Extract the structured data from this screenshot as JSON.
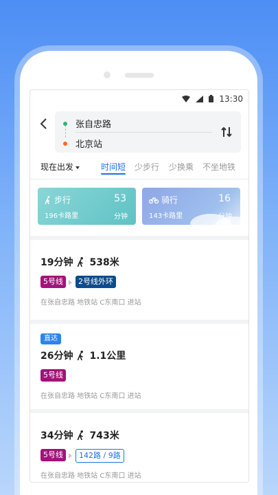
{
  "status": {
    "time": "13:30"
  },
  "route": {
    "from": "张自忠路",
    "to": "北京站"
  },
  "options": {
    "depart_label": "现在出发",
    "tabs": [
      {
        "label": "时间短",
        "active": true
      },
      {
        "label": "少步行",
        "active": false
      },
      {
        "label": "少换乘",
        "active": false
      },
      {
        "label": "不坐地铁",
        "active": false
      }
    ]
  },
  "modes": {
    "walk": {
      "label": "步行",
      "minutes": "53",
      "unit": "分钟",
      "calories": "196卡路里"
    },
    "bike": {
      "label": "骑行",
      "minutes": "16",
      "unit": "分钟",
      "calories": "143卡路里"
    }
  },
  "plans": [
    {
      "duration": "19分钟",
      "walk": "538米",
      "lines": [
        "5号线",
        "2号线外环"
      ],
      "desc": "在张自忠路 地铁站 C东南口 进站"
    },
    {
      "tag": "直达",
      "duration": "26分钟",
      "walk": "1.1公里",
      "lines": [
        "5号线"
      ],
      "desc": "在张自忠路 地铁站 C东南口 进站"
    },
    {
      "duration": "34分钟",
      "walk": "743米",
      "lines": [
        "5号线",
        "142路 / 9路"
      ],
      "desc": "在张自忠路 地铁站 C东南口 进站"
    }
  ],
  "colors": {
    "accent": "#1a73e8",
    "line5": "#a3127a",
    "line2": "#0c4b8c"
  }
}
